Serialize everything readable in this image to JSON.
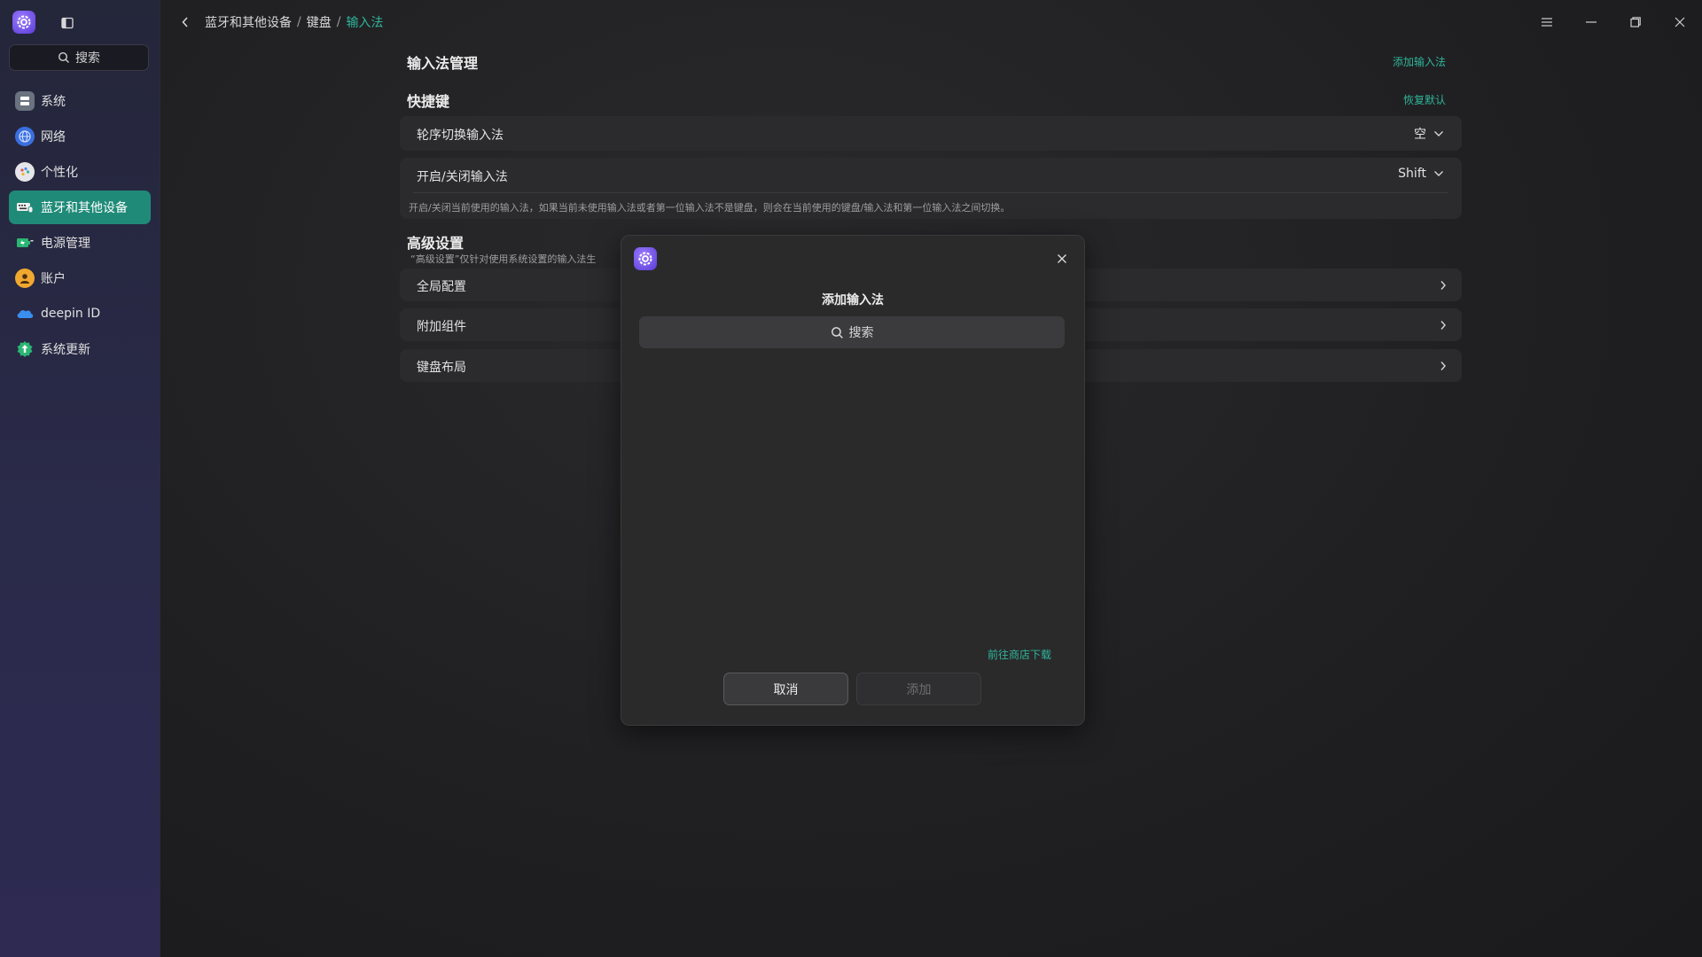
{
  "sidebar": {
    "search_placeholder": "搜索",
    "items": [
      {
        "label": "系统",
        "icon": "system-icon",
        "active": false
      },
      {
        "label": "网络",
        "icon": "network-icon",
        "active": false
      },
      {
        "label": "个性化",
        "icon": "personalization-icon",
        "active": false
      },
      {
        "label": "蓝牙和其他设备",
        "icon": "bluetooth-devices-icon",
        "active": true
      },
      {
        "label": "电源管理",
        "icon": "power-icon",
        "active": false
      },
      {
        "label": "账户",
        "icon": "account-icon",
        "active": false
      },
      {
        "label": "deepin ID",
        "icon": "cloud-icon",
        "active": false
      },
      {
        "label": "系统更新",
        "icon": "update-icon",
        "active": false
      }
    ]
  },
  "breadcrumb": {
    "items": [
      "蓝牙和其他设备",
      "键盘",
      "输入法"
    ],
    "separator": "/"
  },
  "content": {
    "im_manage_title": "输入法管理",
    "add_im_link": "添加输入法",
    "shortcuts_title": "快捷键",
    "restore_default_link": "恢复默认",
    "cycle_im_label": "轮序切换输入法",
    "cycle_im_value": "空",
    "toggle_im_label": "开启/关闭输入法",
    "toggle_im_value": "Shift",
    "toggle_im_hint": "开启/关闭当前使用的输入法，如果当前未使用输入法或者第一位输入法不是键盘，则会在当前使用的键盘/输入法和第一位输入法之间切换。",
    "advanced_title": "高级设置",
    "advanced_hint": "“高级设置”仅针对使用系统设置的输入法生",
    "global_config_label": "全局配置",
    "addons_label": "附加组件",
    "keyboard_layout_label": "键盘布局"
  },
  "dialog": {
    "title": "添加输入法",
    "search_placeholder": "搜索",
    "store_link": "前往商店下载",
    "cancel_label": "取消",
    "add_label": "添加"
  },
  "colors": {
    "accent": "#2fb59b",
    "active_nav": "#1f8a78"
  }
}
